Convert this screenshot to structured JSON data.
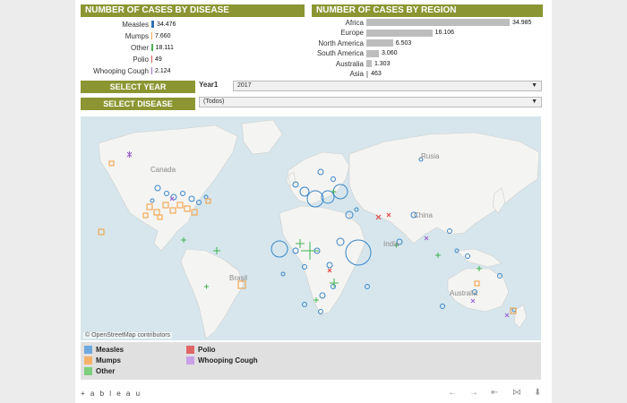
{
  "disease_section": {
    "title": "NUMBER OF CASES BY DISEASE",
    "rows": [
      {
        "label": "Measles",
        "value": "34.476",
        "amount": 34476,
        "color": "#2e6fb5"
      },
      {
        "label": "Mumps",
        "value": "7.660",
        "amount": 7660,
        "color": "#f5a14b"
      },
      {
        "label": "Other",
        "value": "18.111",
        "amount": 18111,
        "color": "#4caf50"
      },
      {
        "label": "Polio",
        "value": "49",
        "amount": 49,
        "color": "#e05555"
      },
      {
        "label": "Whooping Cough",
        "value": "2.124",
        "amount": 2124,
        "color": "#a070d0"
      }
    ]
  },
  "region_section": {
    "title": "NUMBER OF CASES BY REGION",
    "rows": [
      {
        "label": "Africa",
        "value": "34.985",
        "amount": 34985
      },
      {
        "label": "Europe",
        "value": "16.106",
        "amount": 16106
      },
      {
        "label": "North America",
        "value": "6.503",
        "amount": 6503
      },
      {
        "label": "South America",
        "value": "3.060",
        "amount": 3060
      },
      {
        "label": "Australia",
        "value": "1.303",
        "amount": 1303
      },
      {
        "label": "Asia",
        "value": "463",
        "amount": 463
      }
    ]
  },
  "filters": {
    "select_year_button": "SELECT YEAR",
    "year_label": "Year1",
    "year_value": "2017",
    "select_disease_button": "SELECT DISEASE",
    "disease_value": "(Todos)"
  },
  "map": {
    "labels": {
      "canada": "Canada",
      "russia": "Rusia",
      "china": "China",
      "india": "India",
      "brasil": "Brasil",
      "australia": "Australia"
    },
    "attribution": "© OpenStreetMap contributors"
  },
  "legend": {
    "items": [
      {
        "label": "Measles",
        "color": "#6fa8dc"
      },
      {
        "label": "Polio",
        "color": "#e06666"
      },
      {
        "label": "Mumps",
        "color": "#f6b26b"
      },
      {
        "label": "Whooping Cough",
        "color": "#c9a0e8"
      },
      {
        "label": "Other",
        "color": "#7dcf7d"
      }
    ]
  },
  "footer": {
    "logo": "+ a b l e a u",
    "icons": [
      "undo-icon",
      "redo-icon",
      "revert-icon",
      "share-icon",
      "download-icon"
    ]
  }
}
